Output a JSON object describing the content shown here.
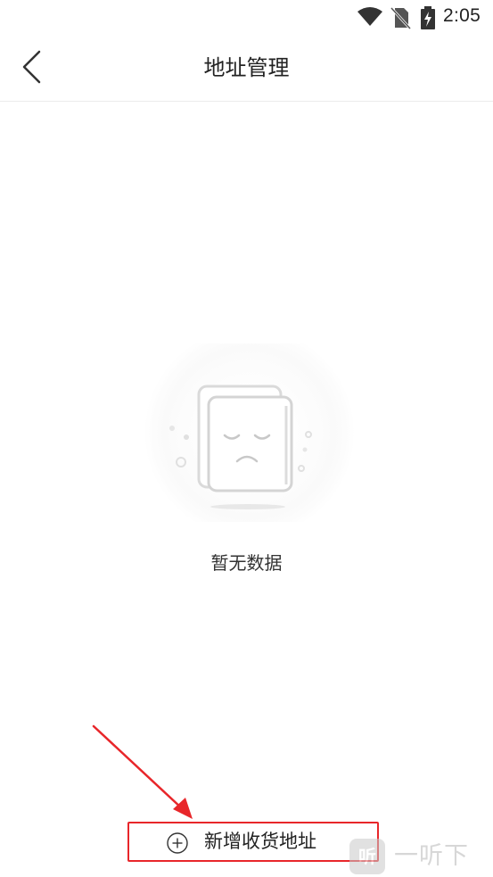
{
  "status_bar": {
    "time": "2:05",
    "icons": [
      "wifi-icon",
      "no-sim-icon",
      "battery-charging-icon"
    ]
  },
  "header": {
    "back_icon": "chevron-left-icon",
    "title": "地址管理"
  },
  "empty_state": {
    "illustration": "sad-document-icon",
    "message": "暂无数据"
  },
  "add_address": {
    "icon": "plus-circle-icon",
    "label": "新增收货地址",
    "highlight_color": "#e8262a"
  },
  "watermark": {
    "logo_text": "听",
    "text": "一听下载"
  }
}
